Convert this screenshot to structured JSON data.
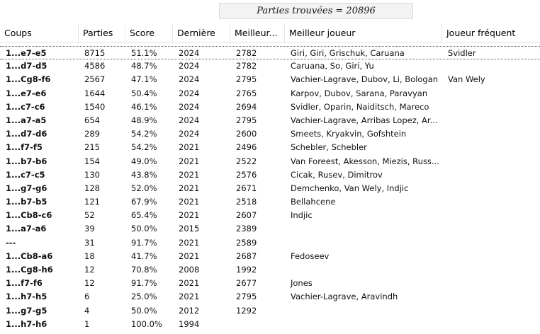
{
  "summary": "Parties trouvées = 20896",
  "columns": [
    "Coups",
    "Parties",
    "Score",
    "Dernière",
    "Meilleur...",
    "Meilleur joueur",
    "Joueur fréquent"
  ],
  "rows": [
    {
      "move": "1...e7-e5",
      "games": "8715",
      "score": "51.1%",
      "last": "2024",
      "best": "2782",
      "best_player": "Giri, Giri, Grischuk, Caruana",
      "frequent": "Svidler"
    },
    {
      "move": "1...d7-d5",
      "games": "4586",
      "score": "48.7%",
      "last": "2024",
      "best": "2782",
      "best_player": "Caruana, So, Giri, Yu",
      "frequent": ""
    },
    {
      "move": "1...Cg8-f6",
      "games": "2567",
      "score": "47.1%",
      "last": "2024",
      "best": "2795",
      "best_player": "Vachier-Lagrave, Dubov, Li, Bologan",
      "frequent": "Van Wely"
    },
    {
      "move": "1...e7-e6",
      "games": "1644",
      "score": "50.4%",
      "last": "2024",
      "best": "2765",
      "best_player": "Karpov, Dubov, Sarana, Paravyan",
      "frequent": ""
    },
    {
      "move": "1...c7-c6",
      "games": "1540",
      "score": "46.1%",
      "last": "2024",
      "best": "2694",
      "best_player": "Svidler, Oparin, Naiditsch, Mareco",
      "frequent": ""
    },
    {
      "move": "1...a7-a5",
      "games": "654",
      "score": "48.9%",
      "last": "2024",
      "best": "2795",
      "best_player": "Vachier-Lagrave, Arribas Lopez, Ar...",
      "frequent": ""
    },
    {
      "move": "1...d7-d6",
      "games": "289",
      "score": "54.2%",
      "last": "2024",
      "best": "2600",
      "best_player": "Smeets, Kryakvin, Gofshtein",
      "frequent": ""
    },
    {
      "move": "1...f7-f5",
      "games": "215",
      "score": "54.2%",
      "last": "2021",
      "best": "2496",
      "best_player": "Schebler, Schebler",
      "frequent": ""
    },
    {
      "move": "1...b7-b6",
      "games": "154",
      "score": "49.0%",
      "last": "2021",
      "best": "2522",
      "best_player": "Van Foreest, Akesson, Miezis, Russ...",
      "frequent": ""
    },
    {
      "move": "1...c7-c5",
      "games": "130",
      "score": "43.8%",
      "last": "2021",
      "best": "2576",
      "best_player": "Cicak, Rusev, Dimitrov",
      "frequent": ""
    },
    {
      "move": "1...g7-g6",
      "games": "128",
      "score": "52.0%",
      "last": "2021",
      "best": "2671",
      "best_player": "Demchenko, Van Wely, Indjic",
      "frequent": ""
    },
    {
      "move": "1...b7-b5",
      "games": "121",
      "score": "67.9%",
      "last": "2021",
      "best": "2518",
      "best_player": "Bellahcene",
      "frequent": ""
    },
    {
      "move": "1...Cb8-c6",
      "games": "52",
      "score": "65.4%",
      "last": "2021",
      "best": "2607",
      "best_player": "Indjic",
      "frequent": ""
    },
    {
      "move": "1...a7-a6",
      "games": "39",
      "score": "50.0%",
      "last": "2015",
      "best": "2389",
      "best_player": "",
      "frequent": ""
    },
    {
      "move": "---",
      "games": "31",
      "score": "91.7%",
      "last": "2021",
      "best": "2589",
      "best_player": "",
      "frequent": ""
    },
    {
      "move": "1...Cb8-a6",
      "games": "18",
      "score": "41.7%",
      "last": "2021",
      "best": "2687",
      "best_player": "Fedoseev",
      "frequent": ""
    },
    {
      "move": "1...Cg8-h6",
      "games": "12",
      "score": "70.8%",
      "last": "2008",
      "best": "1992",
      "best_player": "",
      "frequent": ""
    },
    {
      "move": "1...f7-f6",
      "games": "12",
      "score": "91.7%",
      "last": "2021",
      "best": "2677",
      "best_player": "Jones",
      "frequent": ""
    },
    {
      "move": "1...h7-h5",
      "games": "6",
      "score": "25.0%",
      "last": "2021",
      "best": "2795",
      "best_player": "Vachier-Lagrave, Aravindh",
      "frequent": ""
    },
    {
      "move": "1...g7-g5",
      "games": "4",
      "score": "50.0%",
      "last": "2012",
      "best": "1292",
      "best_player": "",
      "frequent": ""
    },
    {
      "move": "1...h7-h6",
      "games": "1",
      "score": "100.0%",
      "last": "1994",
      "best": "",
      "best_player": "",
      "frequent": ""
    }
  ]
}
